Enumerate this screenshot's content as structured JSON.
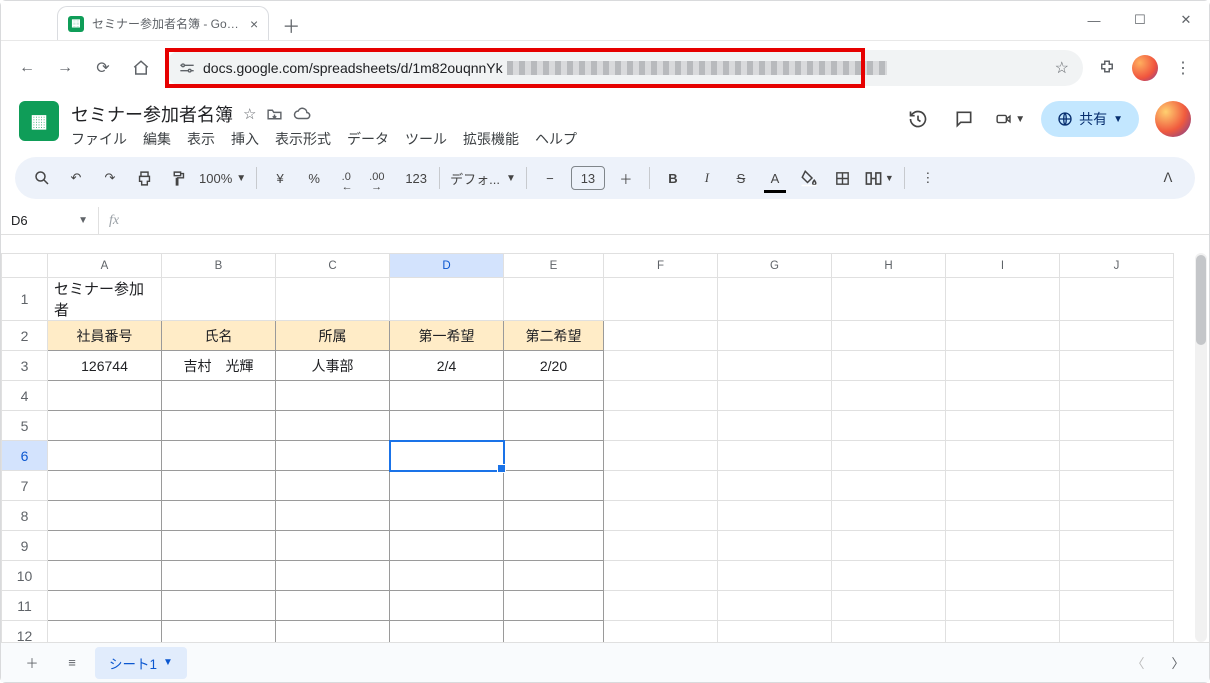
{
  "browser": {
    "tab_title": "セミナー参加者名簿 - Google スプ",
    "url": "docs.google.com/spreadsheets/d/1m82ouqnnYk"
  },
  "doc": {
    "title": "セミナー参加者名簿",
    "menus": [
      "ファイル",
      "編集",
      "表示",
      "挿入",
      "表示形式",
      "データ",
      "ツール",
      "拡張機能",
      "ヘルプ"
    ],
    "share_label": "共有"
  },
  "toolbar": {
    "zoom": "100%",
    "currency": "¥",
    "percent": "%",
    "dec_dec": ".0",
    "dec_inc": ".00",
    "numfmt": "123",
    "font": "デフォ...",
    "size": "13",
    "bold": "B",
    "italic": "I"
  },
  "namebox": {
    "cell": "D6"
  },
  "columns": [
    "A",
    "B",
    "C",
    "D",
    "E",
    "F",
    "G",
    "H",
    "I",
    "J"
  ],
  "rows": [
    "1",
    "2",
    "3",
    "4",
    "5",
    "6",
    "7",
    "8",
    "9",
    "10",
    "11",
    "12"
  ],
  "selected": {
    "col": "D",
    "row": "6"
  },
  "content": {
    "title_cell": "セミナー参加者",
    "headers": [
      "社員番号",
      "氏名",
      "所属",
      "第一希望",
      "第二希望"
    ],
    "row3": [
      "126744",
      "吉村　光輝",
      "人事部",
      "2/4",
      "2/20"
    ]
  },
  "tabs": {
    "sheet1": "シート1"
  }
}
